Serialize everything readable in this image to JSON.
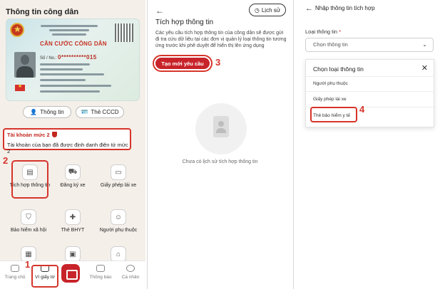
{
  "panel1": {
    "title": "Thông tin công dân",
    "card": {
      "country_title": "CỘNG HÒA XÃ HỘI CHỦ NGHĨA VIỆT NAM",
      "card_title": "CĂN CƯỚC CÔNG DÂN",
      "id_prefix": "Số / No.:",
      "id_number": "0**********015"
    },
    "btn_info_label": "Thông tin",
    "btn_cccd_label": "Thẻ CCCD",
    "account": {
      "title": "Tài khoản mức 2",
      "desc": "Tài khoản của bạn đã được định danh điện tử mức 2"
    },
    "grid": [
      {
        "label": "Tích hợp thông tin",
        "icon": "document-plus-icon"
      },
      {
        "label": "Đăng ký xe",
        "icon": "car-icon"
      },
      {
        "label": "Giấy phép lái xe",
        "icon": "license-icon"
      },
      {
        "label": "Bảo hiểm xã hội",
        "icon": "shield-icon"
      },
      {
        "label": "Thẻ BHYT",
        "icon": "health-card-icon"
      },
      {
        "label": "Người phụ thuộc",
        "icon": "dependent-icon"
      }
    ],
    "nav": {
      "home": "Trang chủ",
      "wallet": "Ví giấy tờ",
      "notifications": "Thông báo",
      "profile": "Cá nhân"
    },
    "step_labels": [
      "1",
      "2"
    ]
  },
  "panel2": {
    "back_icon": "arrow-left-icon",
    "history_label": "Lịch sử",
    "title": "Tích hợp thông tin",
    "desc": "Các yêu cầu tích hợp thông tin của công dân sẽ được gửi đi tra cứu dữ liệu tại các đơn vị quản lý loại thông tin tương ứng trước khi phê duyệt để hiển thị lên ứng dụng",
    "new_request_label": "Tạo mới yêu cầu",
    "empty_text": "Chưa có lịch sử tích hợp thông tin",
    "step_label": "3"
  },
  "panel3": {
    "title": "Nhập thông tin tích hợp",
    "field_label": "Loại thông tin",
    "required_mark": "*",
    "select_placeholder": "Chọn thông tin",
    "modal_title": "Chọn loại thông tin",
    "options": [
      "Người phụ thuộc",
      "Giấy phép lái xe",
      "Thẻ bảo hiểm y tế"
    ],
    "step_label": "4"
  },
  "colors": {
    "brand_red": "#c8232a",
    "highlight_red": "#d6342a",
    "panel1_bg": "#f4efe9"
  }
}
